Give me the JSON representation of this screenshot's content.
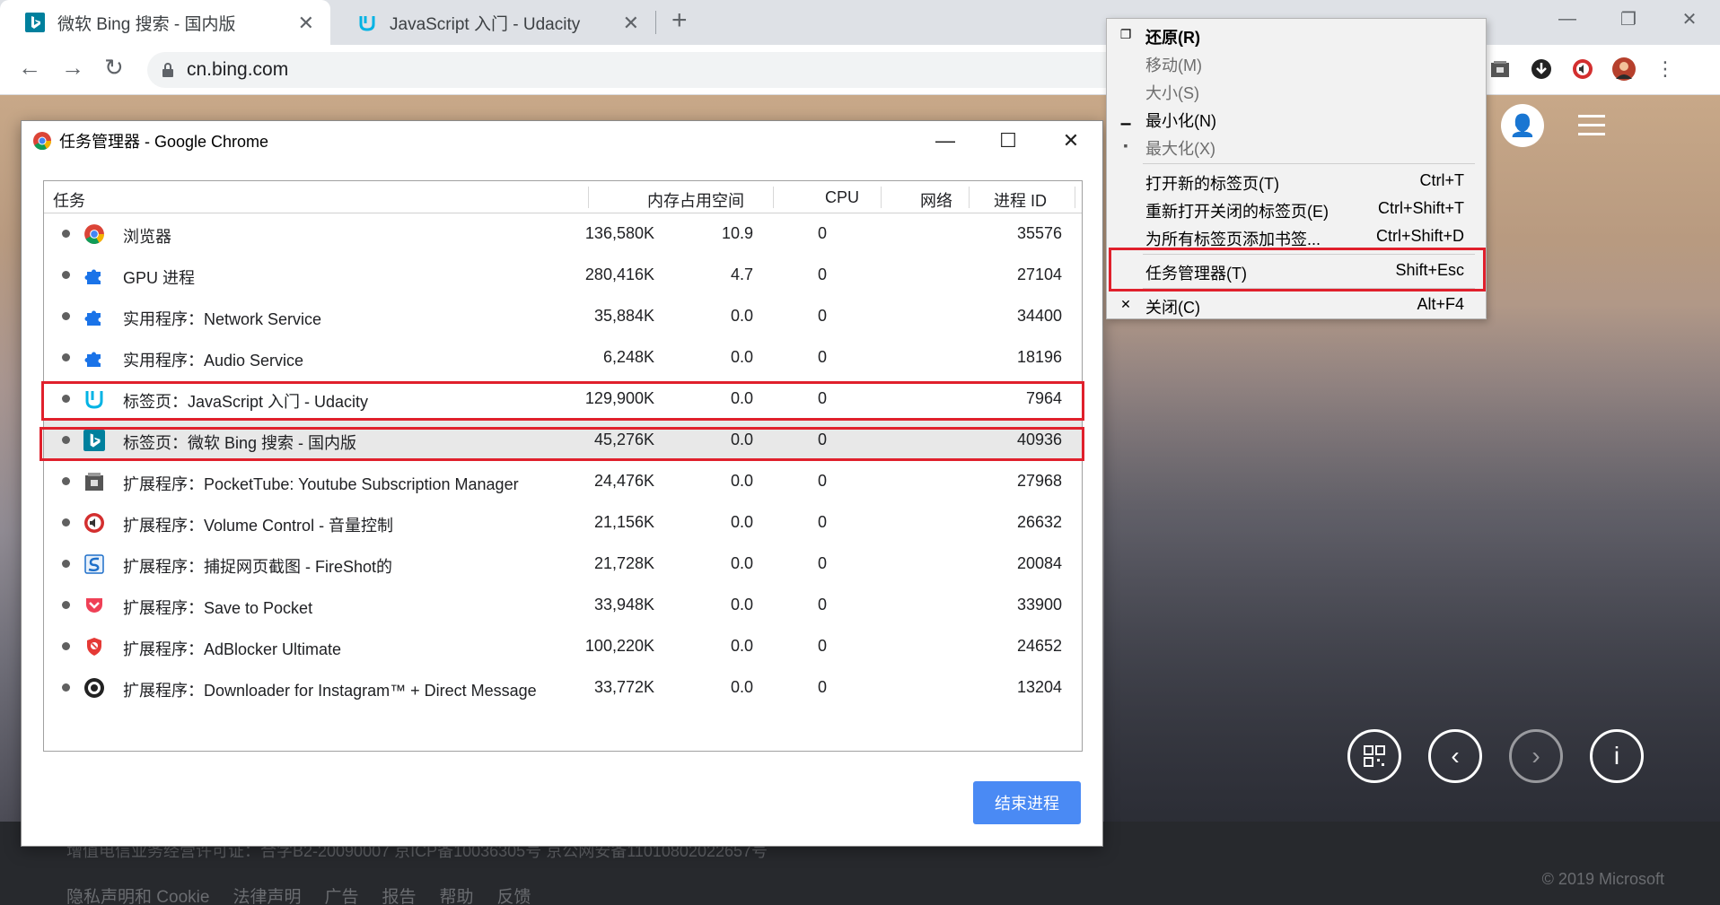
{
  "browser": {
    "tabs": [
      {
        "title": "微软 Bing 搜索 - 国内版",
        "active": true
      },
      {
        "title": "JavaScript 入门 - Udacity",
        "active": false
      }
    ],
    "address": "cn.bing.com"
  },
  "page": {
    "footer_line": "增值电信业务经营许可证：合字B2-20090007      京ICP备10036305号      京公网安备11010802022657号",
    "footer_links": [
      "隐私声明和 Cookie",
      "法律声明",
      "广告",
      "报告",
      "帮助",
      "反馈"
    ],
    "copyright": "© 2019 Microsoft"
  },
  "task_manager": {
    "title": "任务管理器 - Google Chrome",
    "columns": {
      "task": "任务",
      "memory": "内存占用空间",
      "cpu": "CPU",
      "network": "网络",
      "pid": "进程 ID"
    },
    "rows": [
      {
        "name": "浏览器",
        "memory": "136,580K",
        "cpu": "10.9",
        "network": "0",
        "pid": "35576",
        "icon": "chrome-icon"
      },
      {
        "name": "GPU 进程",
        "memory": "280,416K",
        "cpu": "4.7",
        "network": "0",
        "pid": "27104",
        "icon": "puzzle-icon"
      },
      {
        "name": "实用程序：Network Service",
        "memory": "35,884K",
        "cpu": "0.0",
        "network": "0",
        "pid": "34400",
        "icon": "puzzle-icon"
      },
      {
        "name": "实用程序：Audio Service",
        "memory": "6,248K",
        "cpu": "0.0",
        "network": "0",
        "pid": "18196",
        "icon": "puzzle-icon"
      },
      {
        "name": "标签页：JavaScript 入门 - Udacity",
        "memory": "129,900K",
        "cpu": "0.0",
        "network": "0",
        "pid": "7964",
        "icon": "udacity-icon"
      },
      {
        "name": "标签页：微软 Bing 搜索 - 国内版",
        "memory": "45,276K",
        "cpu": "0.0",
        "network": "0",
        "pid": "40936",
        "icon": "bing-icon"
      },
      {
        "name": "扩展程序：PocketTube: Youtube Subscription Manager",
        "memory": "24,476K",
        "cpu": "0.0",
        "network": "0",
        "pid": "27968",
        "icon": "pockettube-icon"
      },
      {
        "name": "扩展程序：Volume Control - 音量控制",
        "memory": "21,156K",
        "cpu": "0.0",
        "network": "0",
        "pid": "26632",
        "icon": "volume-icon"
      },
      {
        "name": "扩展程序：捕捉网页截图 - FireShot的",
        "memory": "21,728K",
        "cpu": "0.0",
        "network": "0",
        "pid": "20084",
        "icon": "fireshot-icon"
      },
      {
        "name": "扩展程序：Save to Pocket",
        "memory": "33,948K",
        "cpu": "0.0",
        "network": "0",
        "pid": "33900",
        "icon": "pocket-icon"
      },
      {
        "name": "扩展程序：AdBlocker Ultimate",
        "memory": "100,220K",
        "cpu": "0.0",
        "network": "0",
        "pid": "24652",
        "icon": "adblocker-icon"
      },
      {
        "name": "扩展程序：Downloader for Instagram™ + Direct Message",
        "memory": "33,772K",
        "cpu": "0.0",
        "network": "0",
        "pid": "13204",
        "icon": "instagram-downloader-icon"
      }
    ],
    "end_button": "结束进程"
  },
  "system_menu": {
    "items": [
      {
        "label": "还原(R)",
        "shortcut": "",
        "disabled": false,
        "bold": true
      },
      {
        "label": "移动(M)",
        "shortcut": "",
        "disabled": true
      },
      {
        "label": "大小(S)",
        "shortcut": "",
        "disabled": true
      },
      {
        "label": "最小化(N)",
        "shortcut": "",
        "disabled": false
      },
      {
        "label": "最大化(X)",
        "shortcut": "",
        "disabled": true
      },
      {
        "label": "打开新的标签页(T)",
        "shortcut": "Ctrl+T",
        "disabled": false
      },
      {
        "label": "重新打开关闭的标签页(E)",
        "shortcut": "Ctrl+Shift+T",
        "disabled": false
      },
      {
        "label": "为所有标签页添加书签...",
        "shortcut": "Ctrl+Shift+D",
        "disabled": false
      },
      {
        "label": "任务管理器(T)",
        "shortcut": "Shift+Esc",
        "disabled": false
      },
      {
        "label": "关闭(C)",
        "shortcut": "Alt+F4",
        "disabled": false
      }
    ]
  },
  "colors": {
    "highlight": "#e0202c",
    "accent_button": "#4a8af4"
  }
}
